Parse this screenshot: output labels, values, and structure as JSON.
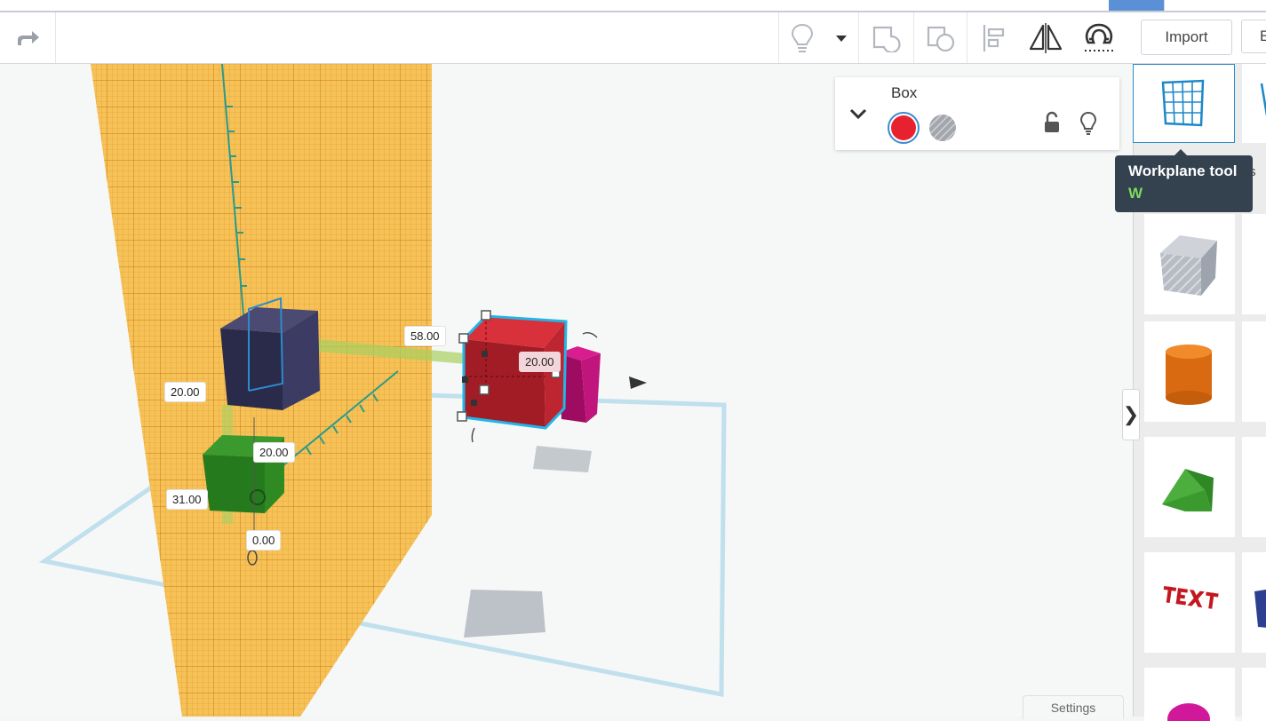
{
  "toolbar": {
    "import_label": "Import",
    "export_label": "E",
    "icons": [
      "redo-icon",
      "show-all-icon",
      "dropdown-icon",
      "group-icon",
      "ungroup-icon",
      "align-icon",
      "mirror-icon",
      "cruise-icon"
    ]
  },
  "inspector": {
    "title": "Box",
    "solid_color": "#e8212e",
    "icons": [
      "collapse-chevron-icon",
      "solid-color-swatch",
      "hole-swatch",
      "unlock-icon",
      "lightbulb-icon"
    ]
  },
  "sidebar": {
    "tooltip_title": "Workplane tool",
    "tooltip_key": "W",
    "behind_text": "s",
    "shapes": [
      "box-hole-icon",
      "cylinder-icon",
      "roof-icon",
      "text-icon",
      "sphere-icon"
    ]
  },
  "viewport": {
    "dimensions": {
      "d1": "58.00",
      "d2": "20.00",
      "d3": "20.00",
      "d4": "20.00",
      "d5": "31.00",
      "d6": "0.00"
    }
  },
  "footer": {
    "settings_label": "Settings"
  }
}
